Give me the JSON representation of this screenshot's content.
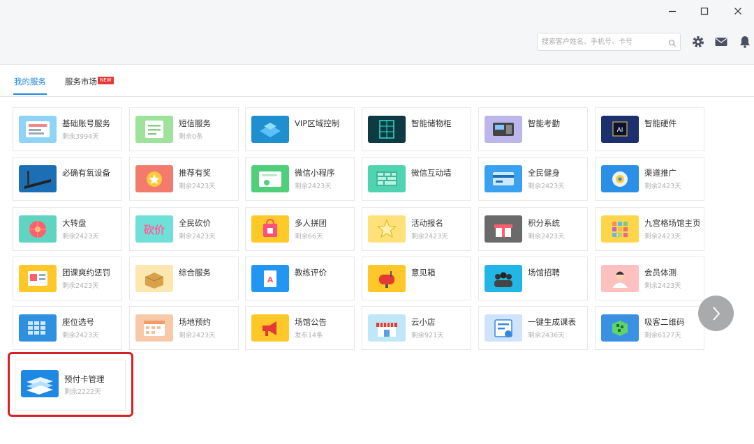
{
  "window_controls": {
    "minimize": "–",
    "maximize": "☐",
    "close": "✕"
  },
  "search": {
    "placeholder": "搜索客户姓名、手机号、卡号"
  },
  "toolbar_icons": [
    "gear-icon",
    "mail-icon",
    "bell-icon"
  ],
  "tabs": [
    {
      "label": "我的服务",
      "active": true
    },
    {
      "label": "服务市场",
      "badge": "NEW",
      "active": false
    }
  ],
  "accent_color": "#1e88e5",
  "highlight_color": "#d71f28",
  "services": [
    {
      "name": "基础账号服务",
      "sub": "剩余3994天",
      "icon": "account-icon",
      "bg": "#8fd3f6"
    },
    {
      "name": "短信服务",
      "sub": "剩余0条",
      "icon": "sms-icon",
      "bg": "#9ee29c"
    },
    {
      "name": "VIP区域控制",
      "sub": "",
      "icon": "vip-zone-icon",
      "bg": "#1f8fd0"
    },
    {
      "name": "智能储物柜",
      "sub": "",
      "icon": "locker-icon",
      "bg": "#0e3a43"
    },
    {
      "name": "智能考勤",
      "sub": "",
      "icon": "attendance-icon",
      "bg": "#bdb6ea"
    },
    {
      "name": "智能硬件",
      "sub": "",
      "icon": "ai-chip-icon",
      "bg": "#1c2f6e"
    },
    {
      "name": "必确有氧设备",
      "sub": "",
      "icon": "treadmill-icon",
      "bg": "#1c6fb5"
    },
    {
      "name": "推荐有奖",
      "sub": "剩余2423天",
      "icon": "reward-icon",
      "bg": "#f37b6e"
    },
    {
      "name": "微信小程序",
      "sub": "剩余2423天",
      "icon": "miniprogram-icon",
      "bg": "#4fcf7a"
    },
    {
      "name": "微信互动墙",
      "sub": "",
      "icon": "wall-icon",
      "bg": "#50d3b0"
    },
    {
      "name": "全民健身",
      "sub": "剩余2423天",
      "icon": "fitness-card-icon",
      "bg": "#3aa0f0"
    },
    {
      "name": "渠道推广",
      "sub": "剩余2423天",
      "icon": "channel-icon",
      "bg": "#2b8fe8"
    },
    {
      "name": "大转盘",
      "sub": "剩余2423天",
      "icon": "wheel-icon",
      "bg": "#5fd4c0"
    },
    {
      "name": "全民砍价",
      "sub": "剩余2423天",
      "icon": "bargain-icon",
      "bg": "#6fe0d8"
    },
    {
      "name": "多人拼团",
      "sub": "剩余66天",
      "icon": "group-buy-icon",
      "bg": "#ffc928"
    },
    {
      "name": "活动报名",
      "sub": "剩余2423天",
      "icon": "star-icon",
      "bg": "#ffe17a"
    },
    {
      "name": "积分系统",
      "sub": "剩余2423天",
      "icon": "gift-icon",
      "bg": "#6a6a6a"
    },
    {
      "name": "九宫格场馆主页",
      "sub": "剩余2423天",
      "icon": "grid-icon",
      "bg": "#ffd54a"
    },
    {
      "name": "团课爽约惩罚",
      "sub": "剩余2423天",
      "icon": "penalty-icon",
      "bg": "#ffc828"
    },
    {
      "name": "综合服务",
      "sub": "",
      "icon": "box-icon",
      "bg": "#fde7b0"
    },
    {
      "name": "教练评价",
      "sub": "",
      "icon": "clipboard-icon",
      "bg": "#2196f3"
    },
    {
      "name": "意见箱",
      "sub": "",
      "icon": "mailbox-icon",
      "bg": "#ffc828"
    },
    {
      "name": "场馆招聘",
      "sub": "",
      "icon": "team-icon",
      "bg": "#22b6e6"
    },
    {
      "name": "会员体测",
      "sub": "剩余2423天",
      "icon": "person-icon",
      "bg": "#ffc0c0"
    },
    {
      "name": "座位选号",
      "sub": "剩余2423天",
      "icon": "seat-icon",
      "bg": "#2f8fe0"
    },
    {
      "name": "场地预约",
      "sub": "剩余2423天",
      "icon": "calendar-icon",
      "bg": "#f7c9a8"
    },
    {
      "name": "场馆公告",
      "sub": "发布14条",
      "icon": "announce-icon",
      "bg": "#ffc828"
    },
    {
      "name": "云小店",
      "sub": "剩余921天",
      "icon": "shop-icon",
      "bg": "#bfe7f7"
    },
    {
      "name": "一键生成课表",
      "sub": "剩余2436天",
      "icon": "schedule-icon",
      "bg": "#cfe4fb"
    },
    {
      "name": "吸客二维码",
      "sub": "剩余6127天",
      "icon": "qrcode-icon",
      "bg": "#3a90e2"
    },
    {
      "name": "预付卡管理",
      "sub": "剩余2222天",
      "icon": "prepaid-card-icon",
      "bg": "#1e88e5"
    }
  ],
  "next_button": "chevron-right-icon"
}
